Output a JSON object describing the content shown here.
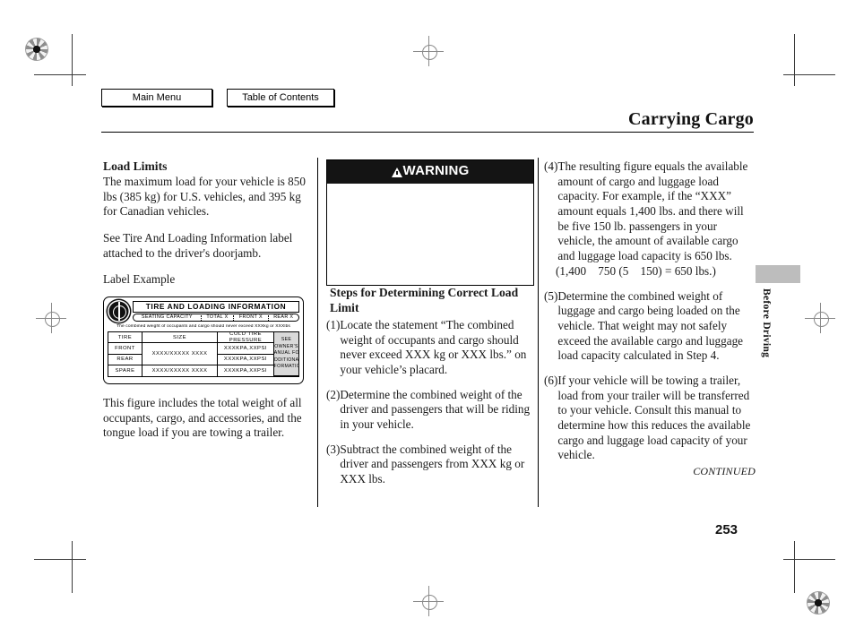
{
  "nav": {
    "main_menu": "Main Menu",
    "table_of_contents": "Table of Contents"
  },
  "header": {
    "title": "Carrying Cargo"
  },
  "left_column": {
    "section_title": "Load Limits",
    "paragraph_1": "The maximum load for your vehicle is 850 lbs (385 kg) for U.S. vehicles, and 395 kg for Canadian vehicles.",
    "paragraph_2": "See Tire And Loading Information label attached to the driver's doorjamb.",
    "figure_caption": "Label Example",
    "paragraph_3": "This figure includes the total weight of all occupants, cargo, and accessories, and the tongue load if you are towing a trailer."
  },
  "tire_label": {
    "title": "TIRE AND LOADING INFORMATION",
    "seating": [
      "SEATING CAPACITY",
      "TOTAL X",
      "FRONT X",
      "REAR X"
    ],
    "note": "The combined weight of occupants and cargo should never exceed XXXkg or XXXlbs",
    "table_headers": [
      "TIRE",
      "SIZE",
      "COLD TIRE PRESSURE"
    ],
    "rows": [
      {
        "position": "FRONT",
        "size": "XXXX/XXXXX XXXX",
        "pressure": "XXXKPA,XXPSI"
      },
      {
        "position": "REAR",
        "size": "XXXX/XXXXX XXXX",
        "pressure": "XXXKPA,XXPSI"
      },
      {
        "position": "SPARE",
        "size": "XXXX/XXXXX XXXX",
        "pressure": "XXXKPA,XXPSI"
      }
    ],
    "owner_note": "SEE OWNER'S MANUAL FOR ADDITIONAL INFORMATION"
  },
  "warning": {
    "label": "WARNING"
  },
  "middle_column": {
    "heading": "Steps for Determining Correct Load Limit",
    "steps": [
      {
        "number": "(1)",
        "text": "Locate the statement “The combined weight of occupants and cargo should never exceed XXX kg or XXX lbs.” on your vehicle’s placard."
      },
      {
        "number": "(2)",
        "text": "Determine the combined weight of the driver and passengers that will be riding in your vehicle."
      },
      {
        "number": "(3)",
        "text": "Subtract the combined weight of the driver and passengers from XXX kg or XXX lbs."
      }
    ]
  },
  "right_column": {
    "steps": [
      {
        "number": "(4)",
        "text": "The resulting figure equals the available amount of cargo and luggage load capacity. For example, if the “XXX” amount equals 1,400 lbs. and there will be five 150 lb. passengers in your vehicle, the amount of available cargo and luggage load capacity is 650 lbs.",
        "equation": "(1,400    750 (5    150) = 650 lbs.)"
      },
      {
        "number": "(5)",
        "text": "Determine the combined weight of luggage and cargo being loaded on the vehicle. That weight may not safely exceed the available cargo and luggage load capacity calculated in Step 4."
      },
      {
        "number": "(6)",
        "text": "If your vehicle will be towing a trailer, load from your trailer will be transferred to your vehicle. Consult this manual to determine how this reduces the available cargo and luggage load capacity of your vehicle."
      }
    ],
    "continued": "CONTINUED"
  },
  "side_tab": {
    "label": "Before Driving"
  },
  "page_number": "253"
}
